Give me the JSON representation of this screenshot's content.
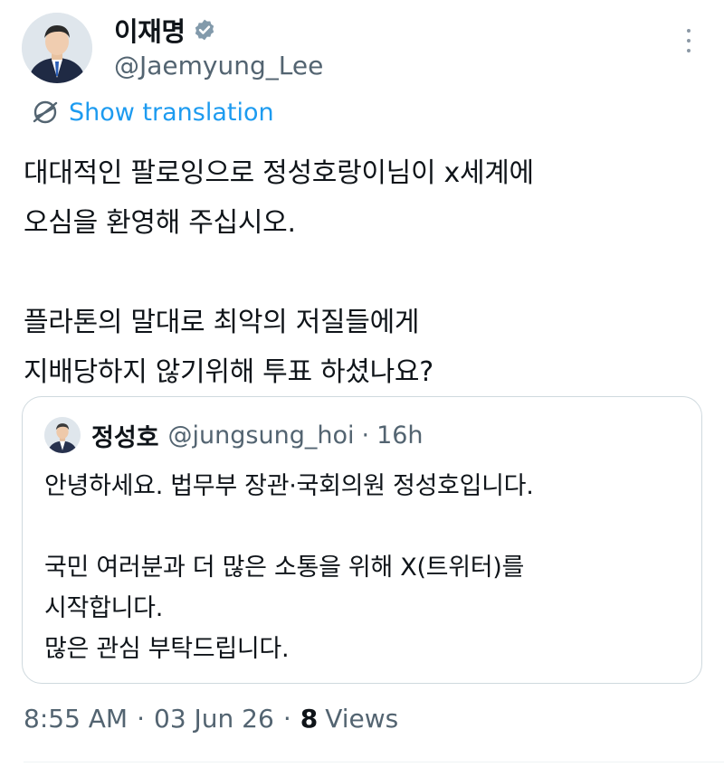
{
  "author": {
    "display_name": "이재명",
    "handle": "@Jaemyung_Lee",
    "verified_badge_icon": "verified-badge-icon",
    "avatar_icon": "profile-avatar"
  },
  "translate": {
    "icon": "globe-icon",
    "label": "Show translation"
  },
  "tweet": {
    "lines_p1": [
      "대대적인 팔로잉으로 정성호랑이님이 x세계에",
      "오심을 환영해 주십시오."
    ],
    "lines_p2": [
      "플라톤의 말대로 최악의 저질들에게",
      "지배당하지 않기위해 투표 하셨나요?"
    ]
  },
  "quoted": {
    "name": "정성호",
    "handle": "@jungsung_hoi",
    "separator": "·",
    "time": "16h",
    "lines_p1": [
      "안녕하세요. 법무부 장관·국회의원 정성호입니다."
    ],
    "lines_p2": [
      "국민 여러분과 더 많은 소통을 위해 X(트위터)를",
      "시작합니다.",
      "많은 관심 부탁드립니다."
    ]
  },
  "meta": {
    "time": "8:55 AM",
    "date": "03 Jun 26",
    "separator": "·",
    "views_count": "8",
    "views_label": "Views"
  },
  "colors": {
    "link": "#1d9bf0",
    "secondary_text": "#536471",
    "border": "#cfd9de"
  }
}
